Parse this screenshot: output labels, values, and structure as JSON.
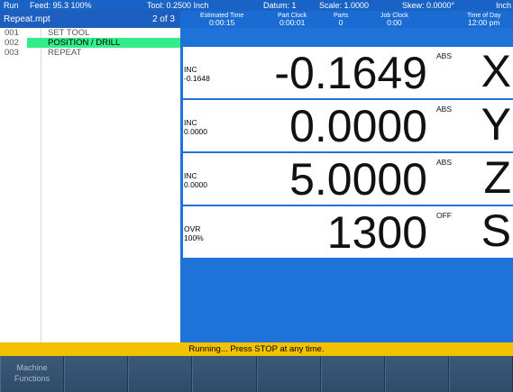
{
  "status": {
    "mode": "Run",
    "feed": "Feed: 95.3 100%",
    "tool": "Tool: 0.2500 Inch",
    "datum": "Datum: 1",
    "scale": "Scale: 1.0000",
    "skew": "Skew: 0.0000°",
    "units": "Inch"
  },
  "program": {
    "filename": "Repeat.mpt",
    "position": "2 of 3",
    "lines": [
      {
        "num": "001",
        "cmd": "SET TOOL",
        "active": false
      },
      {
        "num": "002",
        "cmd": "POSITION / DRILL",
        "active": true
      },
      {
        "num": "003",
        "cmd": "REPEAT",
        "active": false
      }
    ]
  },
  "header": {
    "estimated_time": {
      "label": "Estimated Time",
      "value": "0:00:15"
    },
    "part_clock": {
      "label": "Part Clock",
      "value": "0:00:01"
    },
    "parts": {
      "label": "Parts",
      "value": "0"
    },
    "job_clock": {
      "label": "Job Clock",
      "value": "0:00"
    },
    "time_of_day": {
      "label": "Time of Day",
      "value": "12:00 pm"
    }
  },
  "dro": [
    {
      "sub_label": "INC",
      "sub_value": "-0.1648",
      "value": "-0.1649",
      "mode": "ABS",
      "axis": "X"
    },
    {
      "sub_label": "INC",
      "sub_value": "0.0000",
      "value": "0.0000",
      "mode": "ABS",
      "axis": "Y"
    },
    {
      "sub_label": "INC",
      "sub_value": "0.0000",
      "value": "5.0000",
      "mode": "ABS",
      "axis": "Z"
    },
    {
      "sub_label": "OVR",
      "sub_value": "100%",
      "value": "1300",
      "mode": "OFF",
      "axis": "S"
    }
  ],
  "message": "Running... Press STOP at any time.",
  "softkeys": {
    "key1_line1": "Machine",
    "key1_line2": "Functions"
  },
  "colors": {
    "background_blue": "#1f72d8",
    "active_line": "#33ee88",
    "message_bar": "#f2c200"
  }
}
